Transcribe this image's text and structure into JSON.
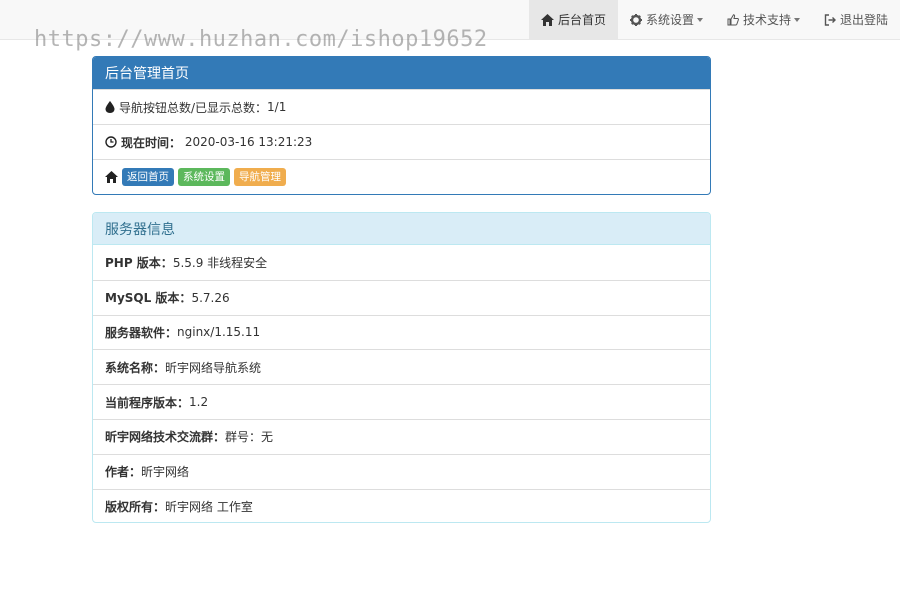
{
  "nav": {
    "items": [
      {
        "label": "后台首页",
        "icon": "home-icon",
        "active": true
      },
      {
        "label": "系统设置",
        "icon": "gear-icon",
        "dropdown": true
      },
      {
        "label": "技术支持",
        "icon": "thumbs-up-icon",
        "dropdown": true
      },
      {
        "label": "退出登陆",
        "icon": "logout-icon"
      }
    ]
  },
  "watermark": "https://www.huzhan.com/ishop19652",
  "admin_panel": {
    "title": "后台管理首页",
    "nav_count_label": "导航按钮总数/已显示总数：",
    "nav_count_value": "1/1",
    "time_label": "现在时间：",
    "time_value": "2020-03-16 13:21:23",
    "quick_links": [
      {
        "label": "返回首页",
        "style": "primary"
      },
      {
        "label": "系统设置",
        "style": "success"
      },
      {
        "label": "导航管理",
        "style": "warning"
      }
    ]
  },
  "server_panel": {
    "title": "服务器信息",
    "rows": [
      {
        "label": "PHP 版本：",
        "value": "5.5.9 非线程安全"
      },
      {
        "label": "MySQL 版本：",
        "value": "5.7.26"
      },
      {
        "label": "服务器软件：",
        "value": "nginx/1.15.11"
      },
      {
        "label": "系统名称：",
        "value": "昕宇网络导航系统"
      },
      {
        "label": "当前程序版本：",
        "value": "1.2"
      },
      {
        "label": "昕宇网络技术交流群：",
        "value": "群号：无"
      },
      {
        "label": "作者：",
        "value": "昕宇网络"
      },
      {
        "label": "版权所有：",
        "value": "昕宇网络 工作室"
      }
    ]
  },
  "colors": {
    "primary": "#337ab7",
    "success": "#5cb85c",
    "warning": "#f0ad4e",
    "info_bg": "#d9edf7",
    "info_text": "#31708f"
  }
}
